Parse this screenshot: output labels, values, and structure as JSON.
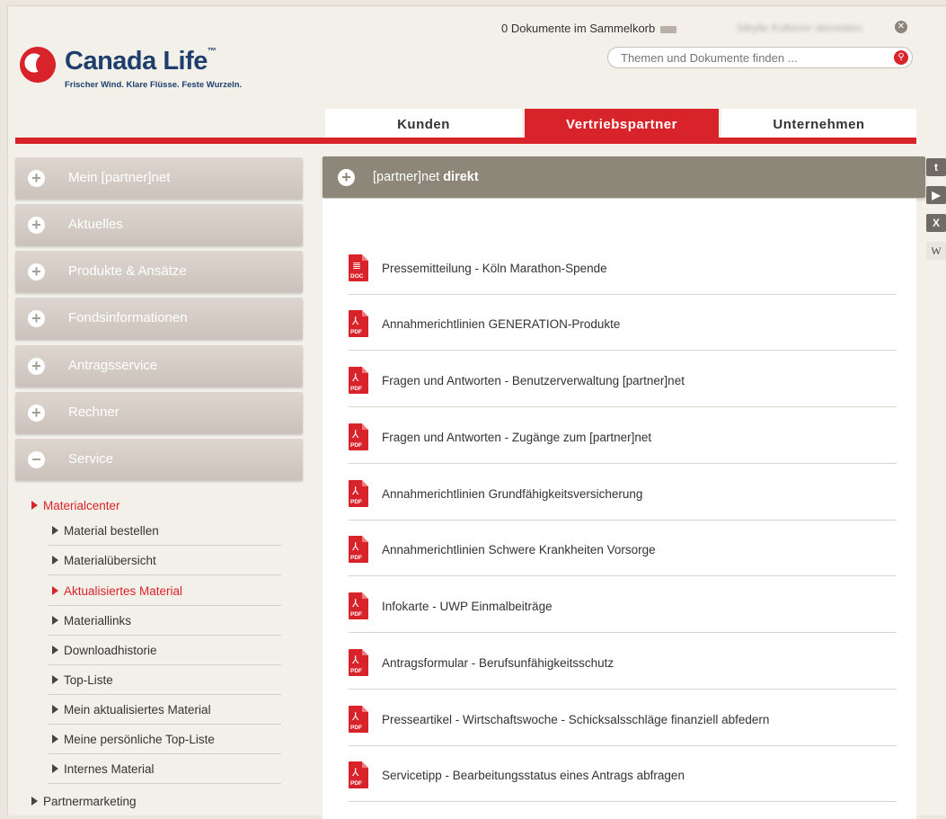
{
  "brand": {
    "name": "Canada Life",
    "trademark": "™",
    "tagline": "Frischer Wind. Klare Flüsse. Feste Wurzeln.",
    "color": "#d8232a"
  },
  "topbar": {
    "cart_text": "0 Dokumente im Sammelkorb",
    "cart_icon": "basket-icon",
    "logout_text": "Sibylle Kulberer abmelden",
    "logout_icon": "close-circle-icon"
  },
  "search": {
    "placeholder": "Themen und Dokumente finden ...",
    "icon": "search-icon"
  },
  "mainnav": {
    "tabs": [
      {
        "label": "Kunden",
        "active": false
      },
      {
        "label": "Vertriebspartner",
        "active": true
      },
      {
        "label": "Unternehmen",
        "active": false
      }
    ]
  },
  "sidebar": {
    "sections": [
      {
        "label": "Mein [partner]net",
        "icon": "plus-icon"
      },
      {
        "label": "Aktuelles",
        "icon": "plus-icon"
      },
      {
        "label": "Produkte & Ansätze",
        "icon": "plus-icon"
      },
      {
        "label": "Fondsinformationen",
        "icon": "plus-icon"
      },
      {
        "label": "Antragsservice",
        "icon": "plus-icon"
      },
      {
        "label": "Rechner",
        "icon": "plus-icon"
      },
      {
        "label": "Service",
        "icon": "minus-icon"
      }
    ],
    "materialcenter": "Materialcenter",
    "subitems": [
      {
        "label": "Material bestellen",
        "active": false
      },
      {
        "label": "Materialübersicht",
        "active": false
      },
      {
        "label": "Aktualisiertes Material",
        "active": true
      },
      {
        "label": "Materiallinks",
        "active": false
      },
      {
        "label": "Downloadhistorie",
        "active": false
      },
      {
        "label": "Top-Liste",
        "active": false
      },
      {
        "label": "Mein aktualisiertes Material",
        "active": false
      },
      {
        "label": "Meine persönliche Top-Liste",
        "active": false
      },
      {
        "label": "Internes Material",
        "active": false
      }
    ],
    "partnermarketing": "Partnermarketing"
  },
  "panel": {
    "title_prefix": "[partner]net",
    "title_bold": "direkt",
    "icon": "plus-icon"
  },
  "documents": [
    {
      "type": "DOC",
      "label": "Pressemitteilung - Köln Marathon-Spende"
    },
    {
      "type": "PDF",
      "label": "Annahmerichtlinien GENERATION-Produkte"
    },
    {
      "type": "PDF",
      "label": "Fragen und Antworten - Benutzerverwaltung [partner]net"
    },
    {
      "type": "PDF",
      "label": "Fragen und Antworten - Zugänge zum [partner]net"
    },
    {
      "type": "PDF",
      "label": "Annahmerichtlinien Grundfähigkeitsversicherung"
    },
    {
      "type": "PDF",
      "label": "Annahmerichtlinien Schwere Krankheiten Vorsorge"
    },
    {
      "type": "PDF",
      "label": "Infokarte - UWP Einmalbeiträge"
    },
    {
      "type": "PDF",
      "label": "Antragsformular - Berufsunfähigkeitsschutz"
    },
    {
      "type": "PDF",
      "label": "Presseartikel - Wirtschaftswoche - Schicksalsschläge finanziell abfedern"
    },
    {
      "type": "PDF",
      "label": "Servicetipp - Bearbeitungsstatus eines Antrags abfragen"
    }
  ],
  "social": [
    {
      "icon": "twitter-icon",
      "glyph": "t"
    },
    {
      "icon": "youtube-icon",
      "glyph": "▶"
    },
    {
      "icon": "xing-icon",
      "glyph": "X"
    },
    {
      "icon": "wikipedia-icon",
      "glyph": "W"
    }
  ]
}
